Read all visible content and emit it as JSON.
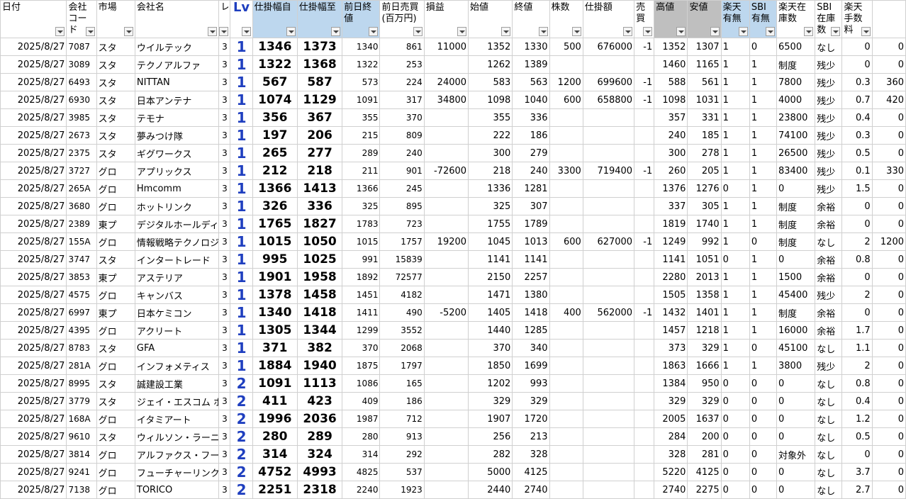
{
  "columns": [
    {
      "label": "日付",
      "style": ""
    },
    {
      "label": "会社コード",
      "style": ""
    },
    {
      "label": "市場",
      "style": ""
    },
    {
      "label": "会社名",
      "style": ""
    },
    {
      "label": "レ",
      "style": ""
    },
    {
      "label": "Lv",
      "style": "lv"
    },
    {
      "label": "仕掛幅自",
      "style": "blue"
    },
    {
      "label": "仕掛幅至",
      "style": "blue"
    },
    {
      "label": "前日終値",
      "style": "blue"
    },
    {
      "label": "前日売買(百万円)",
      "style": ""
    },
    {
      "label": "損益",
      "style": ""
    },
    {
      "label": "始値",
      "style": ""
    },
    {
      "label": "終値",
      "style": ""
    },
    {
      "label": "株数",
      "style": ""
    },
    {
      "label": "仕掛額",
      "style": ""
    },
    {
      "label": "売買",
      "style": ""
    },
    {
      "label": "高値",
      "style": "grey"
    },
    {
      "label": "安値",
      "style": "grey"
    },
    {
      "label": "楽天有無",
      "style": "blue"
    },
    {
      "label": "SBI有無",
      "style": "blue"
    },
    {
      "label": "楽天在庫数",
      "style": ""
    },
    {
      "label": "SBI在庫数",
      "style": ""
    },
    {
      "label": "楽天手数料",
      "style": ""
    },
    {
      "label": "",
      "style": ""
    }
  ],
  "rows": [
    [
      "2025/8/27",
      "7087",
      "スタ",
      "ウイルテック",
      "3",
      "1",
      "1346",
      "1373",
      "1340",
      "861",
      "11000",
      "1352",
      "1330",
      "500",
      "676000",
      "-1",
      "1352",
      "1307",
      "1",
      "0",
      "6500",
      "なし",
      "0",
      "0"
    ],
    [
      "2025/8/27",
      "3089",
      "スタ",
      "テクノアルファ",
      "3",
      "1",
      "1322",
      "1368",
      "1322",
      "253",
      "",
      "1262",
      "1389",
      "",
      "",
      "",
      "1460",
      "1165",
      "1",
      "1",
      "制度",
      "残少",
      "0",
      "0"
    ],
    [
      "2025/8/27",
      "6493",
      "スタ",
      "NITTAN",
      "3",
      "1",
      "567",
      "587",
      "573",
      "224",
      "24000",
      "583",
      "563",
      "1200",
      "699600",
      "-1",
      "588",
      "561",
      "1",
      "1",
      "7800",
      "残少",
      "0.3",
      "360"
    ],
    [
      "2025/8/27",
      "6930",
      "スタ",
      "日本アンテナ",
      "3",
      "1",
      "1074",
      "1129",
      "1091",
      "317",
      "34800",
      "1098",
      "1040",
      "600",
      "658800",
      "-1",
      "1098",
      "1031",
      "1",
      "1",
      "4000",
      "残少",
      "0.7",
      "420"
    ],
    [
      "2025/8/27",
      "3985",
      "スタ",
      "テモナ",
      "3",
      "1",
      "356",
      "367",
      "355",
      "370",
      "",
      "355",
      "336",
      "",
      "",
      "",
      "357",
      "331",
      "1",
      "1",
      "23800",
      "残少",
      "0.4",
      "0"
    ],
    [
      "2025/8/27",
      "2673",
      "スタ",
      "夢みつけ隊",
      "3",
      "1",
      "197",
      "206",
      "215",
      "809",
      "",
      "222",
      "186",
      "",
      "",
      "",
      "240",
      "185",
      "1",
      "1",
      "74100",
      "残少",
      "0.3",
      "0"
    ],
    [
      "2025/8/27",
      "2375",
      "スタ",
      "ギグワークス",
      "3",
      "1",
      "265",
      "277",
      "289",
      "240",
      "",
      "300",
      "279",
      "",
      "",
      "",
      "300",
      "278",
      "1",
      "1",
      "26500",
      "残少",
      "0.5",
      "0"
    ],
    [
      "2025/8/27",
      "3727",
      "グロ",
      "アプリックス",
      "3",
      "1",
      "212",
      "218",
      "211",
      "901",
      "-72600",
      "218",
      "240",
      "3300",
      "719400",
      "-1",
      "260",
      "205",
      "1",
      "1",
      "83400",
      "残少",
      "0.1",
      "330"
    ],
    [
      "2025/8/27",
      "265A",
      "グロ",
      "Hmcomm",
      "3",
      "1",
      "1366",
      "1413",
      "1366",
      "245",
      "",
      "1336",
      "1281",
      "",
      "",
      "",
      "1376",
      "1276",
      "0",
      "1",
      "0",
      "残少",
      "1.5",
      "0"
    ],
    [
      "2025/8/27",
      "3680",
      "グロ",
      "ホットリンク",
      "3",
      "1",
      "326",
      "336",
      "325",
      "895",
      "",
      "325",
      "307",
      "",
      "",
      "",
      "337",
      "305",
      "1",
      "1",
      "制度",
      "余裕",
      "0",
      "0"
    ],
    [
      "2025/8/27",
      "2389",
      "東プ",
      "デジタルホールディ",
      "3",
      "1",
      "1765",
      "1827",
      "1783",
      "723",
      "",
      "1755",
      "1789",
      "",
      "",
      "",
      "1819",
      "1740",
      "1",
      "1",
      "制度",
      "余裕",
      "0",
      "0"
    ],
    [
      "2025/8/27",
      "155A",
      "グロ",
      "情報戦略テクノロジ",
      "3",
      "1",
      "1015",
      "1050",
      "1015",
      "1757",
      "19200",
      "1045",
      "1013",
      "600",
      "627000",
      "-1",
      "1249",
      "992",
      "1",
      "0",
      "制度",
      "なし",
      "2",
      "1200"
    ],
    [
      "2025/8/27",
      "3747",
      "スタ",
      "インタートレード",
      "3",
      "1",
      "995",
      "1025",
      "991",
      "15839",
      "",
      "1141",
      "1141",
      "",
      "",
      "",
      "1141",
      "1051",
      "0",
      "1",
      "0",
      "余裕",
      "0.8",
      "0"
    ],
    [
      "2025/8/27",
      "3853",
      "東プ",
      "アステリア",
      "3",
      "1",
      "1901",
      "1958",
      "1892",
      "72577",
      "",
      "2150",
      "2257",
      "",
      "",
      "",
      "2280",
      "2013",
      "1",
      "1",
      "1500",
      "余裕",
      "0",
      "0"
    ],
    [
      "2025/8/27",
      "4575",
      "グロ",
      "キャンバス",
      "3",
      "1",
      "1378",
      "1458",
      "1451",
      "4182",
      "",
      "1471",
      "1380",
      "",
      "",
      "",
      "1505",
      "1358",
      "1",
      "1",
      "45400",
      "残少",
      "2",
      "0"
    ],
    [
      "2025/8/27",
      "6997",
      "東プ",
      "日本ケミコン",
      "3",
      "1",
      "1340",
      "1418",
      "1411",
      "490",
      "-5200",
      "1405",
      "1418",
      "400",
      "562000",
      "-1",
      "1432",
      "1401",
      "1",
      "1",
      "制度",
      "余裕",
      "0",
      "0"
    ],
    [
      "2025/8/27",
      "4395",
      "グロ",
      "アクリート",
      "3",
      "1",
      "1305",
      "1344",
      "1299",
      "3552",
      "",
      "1440",
      "1285",
      "",
      "",
      "",
      "1457",
      "1218",
      "1",
      "1",
      "16000",
      "余裕",
      "1.7",
      "0"
    ],
    [
      "2025/8/27",
      "8783",
      "スタ",
      "GFA",
      "3",
      "1",
      "371",
      "382",
      "370",
      "2068",
      "",
      "370",
      "340",
      "",
      "",
      "",
      "373",
      "329",
      "1",
      "0",
      "45100",
      "なし",
      "1.1",
      "0"
    ],
    [
      "2025/8/27",
      "281A",
      "グロ",
      "インフォメティス",
      "3",
      "1",
      "1884",
      "1940",
      "1875",
      "1797",
      "",
      "1850",
      "1699",
      "",
      "",
      "",
      "1863",
      "1666",
      "1",
      "1",
      "3800",
      "残少",
      "2",
      "0"
    ],
    [
      "2025/8/27",
      "8995",
      "スタ",
      "誠建設工業",
      "3",
      "2",
      "1091",
      "1113",
      "1086",
      "165",
      "",
      "1202",
      "993",
      "",
      "",
      "",
      "1384",
      "950",
      "0",
      "0",
      "0",
      "なし",
      "0.8",
      "0"
    ],
    [
      "2025/8/27",
      "3779",
      "スタ",
      "ジェイ・エスコム ホー",
      "3",
      "2",
      "411",
      "423",
      "409",
      "186",
      "",
      "329",
      "329",
      "",
      "",
      "",
      "329",
      "329",
      "0",
      "0",
      "0",
      "なし",
      "0.4",
      "0"
    ],
    [
      "2025/8/27",
      "168A",
      "グロ",
      "イタミアート",
      "3",
      "2",
      "1996",
      "2036",
      "1987",
      "712",
      "",
      "1907",
      "1720",
      "",
      "",
      "",
      "2005",
      "1637",
      "0",
      "0",
      "0",
      "なし",
      "1.2",
      "0"
    ],
    [
      "2025/8/27",
      "9610",
      "スタ",
      "ウィルソン・ラーニン",
      "3",
      "2",
      "280",
      "289",
      "280",
      "913",
      "",
      "256",
      "213",
      "",
      "",
      "",
      "284",
      "200",
      "0",
      "0",
      "0",
      "なし",
      "0.5",
      "0"
    ],
    [
      "2025/8/27",
      "3814",
      "グロ",
      "アルファクス・フード",
      "3",
      "2",
      "314",
      "324",
      "314",
      "292",
      "",
      "282",
      "328",
      "",
      "",
      "",
      "328",
      "281",
      "0",
      "0",
      "対象外",
      "なし",
      "0",
      "0"
    ],
    [
      "2025/8/27",
      "9241",
      "グロ",
      "フューチャーリンク",
      "3",
      "2",
      "4752",
      "4993",
      "4825",
      "537",
      "",
      "5000",
      "4125",
      "",
      "",
      "",
      "5220",
      "4125",
      "0",
      "0",
      "0",
      "なし",
      "3.7",
      "0"
    ],
    [
      "2025/8/27",
      "7138",
      "グロ",
      "TORICO",
      "3",
      "2",
      "2251",
      "2318",
      "2240",
      "1923",
      "",
      "2440",
      "2740",
      "",
      "",
      "",
      "2740",
      "2275",
      "0",
      "0",
      "0",
      "なし",
      "2.7",
      "0"
    ]
  ]
}
